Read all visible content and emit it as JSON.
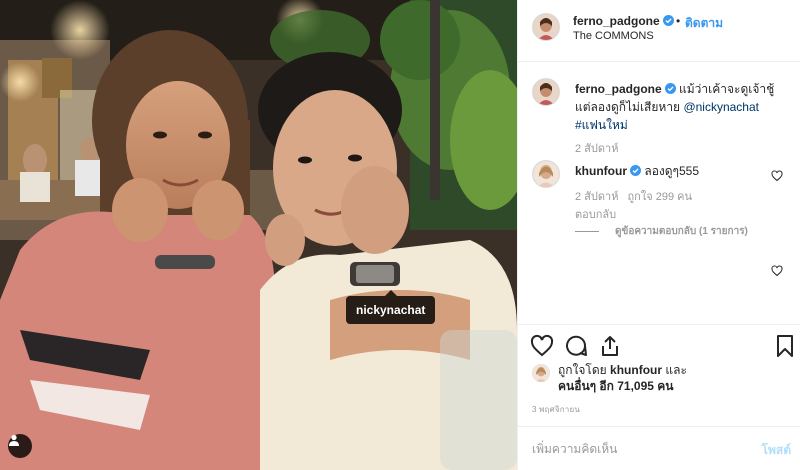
{
  "post": {
    "author": "ferno_padgone",
    "follow_dot": "•",
    "follow_label": "ติดตาม",
    "location": "The COMMONS",
    "photo_tag": "nickynachat",
    "caption": {
      "username": "ferno_padgone",
      "text_1": "แม้ว่าเค้าจะดูเจ้าชู้ แต่ลองดูก็ไม่เสียหาย",
      "mention": "@nickynachat",
      "hashtag": "#แฟนใหม่",
      "time": "2 สัปดาห์"
    },
    "comments": [
      {
        "username": "khunfour",
        "text": "ลองดูๆ555",
        "time": "2 สัปดาห์",
        "likes": "ถูกใจ 299 คน",
        "reply_label": "ตอบกลับ",
        "view_replies": "ดูข้อความตอบกลับ (1 รายการ)"
      }
    ],
    "liked_prefix": "ถูกใจโดย",
    "liked_user": "khunfour",
    "liked_and": "และ",
    "liked_others": "คนอื่นๆ อีก 71,095 คน",
    "date": "3 พฤศจิกายน",
    "comment_placeholder": "เพิ่มความคิดเห็น",
    "post_button": "โพสต์"
  },
  "colors": {
    "link_blue": "#3897f0",
    "mention": "#003569",
    "verified": "#3897f0",
    "post_disabled": "#b2dffc"
  },
  "icons": [
    "verified-badge-icon",
    "heart-icon",
    "comment-icon",
    "share-icon",
    "bookmark-icon",
    "user-tag-icon"
  ]
}
